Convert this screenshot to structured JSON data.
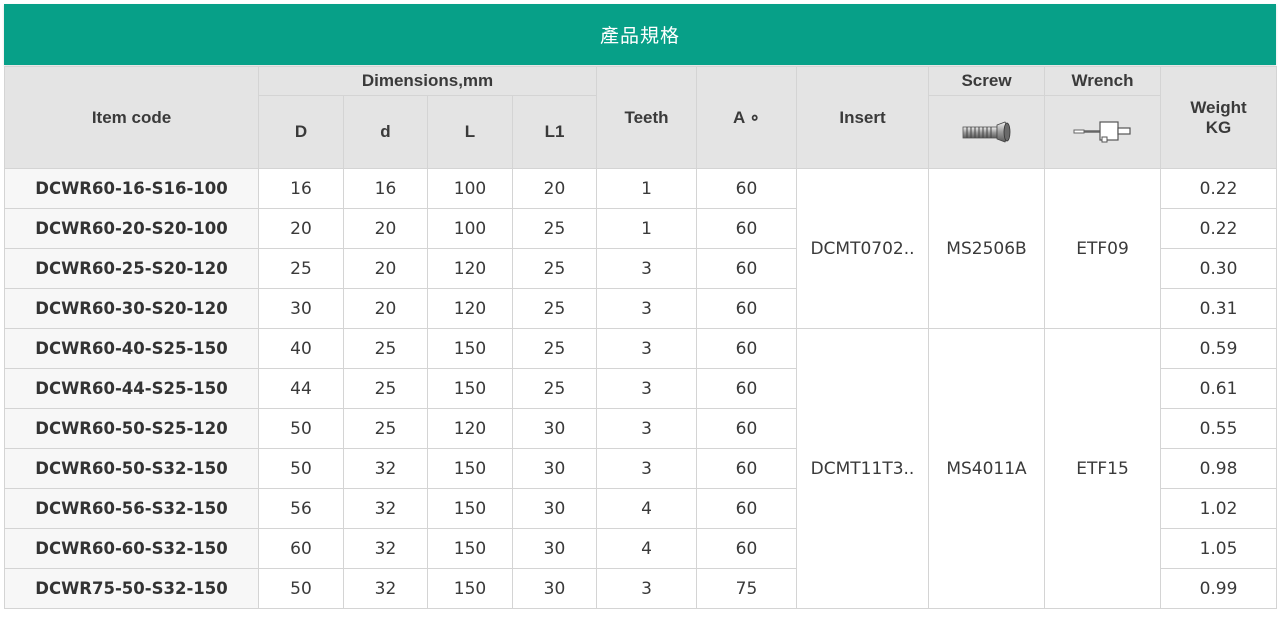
{
  "title": "產品規格",
  "headers": {
    "item_code": "Item code",
    "dimensions": "Dimensions,mm",
    "D": "D",
    "d": "d",
    "L": "L",
    "L1": "L1",
    "teeth": "Teeth",
    "angle": "A ∘",
    "insert": "Insert",
    "screw": "Screw",
    "wrench": "Wrench",
    "weight": "Weight",
    "weight_unit": "KG"
  },
  "icons": {
    "screw": "screw-icon",
    "wrench": "torx-wrench-icon"
  },
  "colors": {
    "title_bar": "#07a088",
    "header_bg": "#e4e4e4",
    "border": "#d4d4d4"
  },
  "groups": [
    {
      "insert": "DCMT0702..",
      "screw": "MS2506B",
      "wrench": "ETF09"
    },
    {
      "insert": "DCMT11T3..",
      "screw": "MS4011A",
      "wrench": "ETF15"
    }
  ],
  "rows": [
    {
      "code": "DCWR60-16-S16-100",
      "D": "16",
      "d": "16",
      "L": "100",
      "L1": "20",
      "teeth": "1",
      "A": "60",
      "weight": "0.22"
    },
    {
      "code": "DCWR60-20-S20-100",
      "D": "20",
      "d": "20",
      "L": "100",
      "L1": "25",
      "teeth": "1",
      "A": "60",
      "weight": "0.22"
    },
    {
      "code": "DCWR60-25-S20-120",
      "D": "25",
      "d": "20",
      "L": "120",
      "L1": "25",
      "teeth": "3",
      "A": "60",
      "weight": "0.30"
    },
    {
      "code": "DCWR60-30-S20-120",
      "D": "30",
      "d": "20",
      "L": "120",
      "L1": "25",
      "teeth": "3",
      "A": "60",
      "weight": "0.31"
    },
    {
      "code": "DCWR60-40-S25-150",
      "D": "40",
      "d": "25",
      "L": "150",
      "L1": "25",
      "teeth": "3",
      "A": "60",
      "weight": "0.59"
    },
    {
      "code": "DCWR60-44-S25-150",
      "D": "44",
      "d": "25",
      "L": "150",
      "L1": "25",
      "teeth": "3",
      "A": "60",
      "weight": "0.61"
    },
    {
      "code": "DCWR60-50-S25-120",
      "D": "50",
      "d": "25",
      "L": "120",
      "L1": "30",
      "teeth": "3",
      "A": "60",
      "weight": "0.55"
    },
    {
      "code": "DCWR60-50-S32-150",
      "D": "50",
      "d": "32",
      "L": "150",
      "L1": "30",
      "teeth": "3",
      "A": "60",
      "weight": "0.98"
    },
    {
      "code": "DCWR60-56-S32-150",
      "D": "56",
      "d": "32",
      "L": "150",
      "L1": "30",
      "teeth": "4",
      "A": "60",
      "weight": "1.02"
    },
    {
      "code": "DCWR60-60-S32-150",
      "D": "60",
      "d": "32",
      "L": "150",
      "L1": "30",
      "teeth": "4",
      "A": "60",
      "weight": "1.05"
    },
    {
      "code": "DCWR75-50-S32-150",
      "D": "50",
      "d": "32",
      "L": "150",
      "L1": "30",
      "teeth": "3",
      "A": "75",
      "weight": "0.99"
    }
  ]
}
